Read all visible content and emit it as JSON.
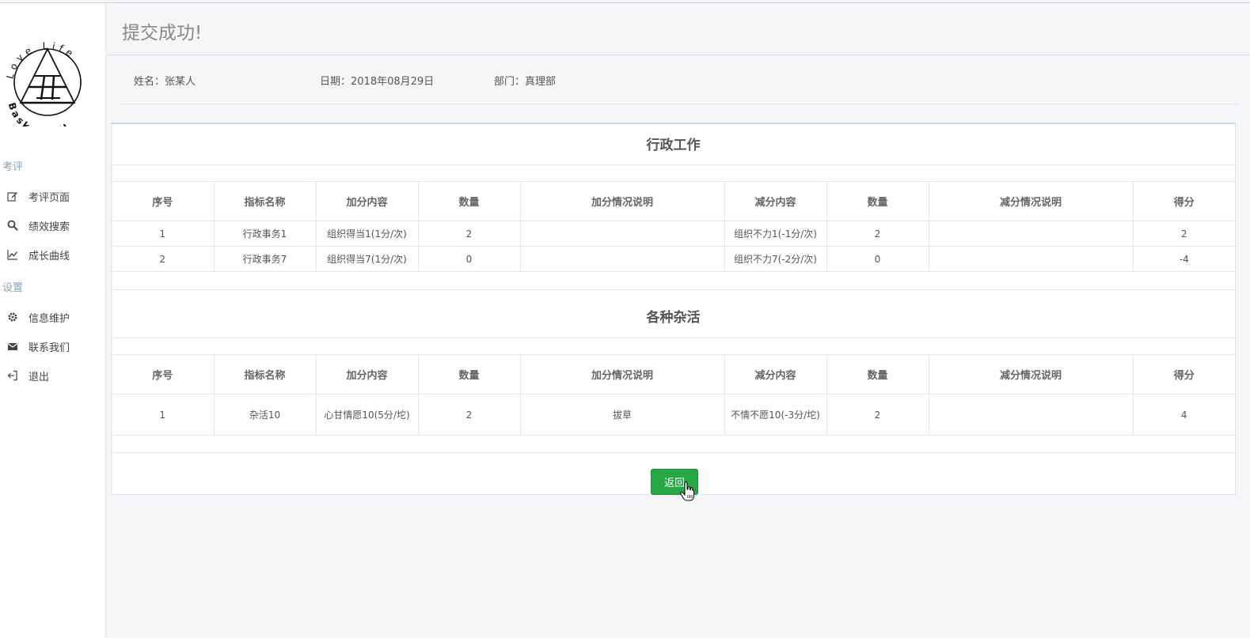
{
  "sidebar": {
    "logo": {
      "top_text": "Love Life",
      "bottom_text": "Basketball"
    },
    "section_review": "考评",
    "items_review": [
      {
        "label": "考评页面",
        "icon": "edit-icon"
      },
      {
        "label": "绩效搜索",
        "icon": "search-icon"
      },
      {
        "label": "成长曲线",
        "icon": "line-chart-icon"
      }
    ],
    "section_settings": "设置",
    "items_settings": [
      {
        "label": "信息维护",
        "icon": "gear-icon"
      },
      {
        "label": "联系我们",
        "icon": "envelope-icon"
      },
      {
        "label": "退出",
        "icon": "sign-out-icon"
      }
    ]
  },
  "header": {
    "title": "提交成功!"
  },
  "info": {
    "name": "姓名：张某人",
    "date": "日期：2018年08月29日",
    "department": "部门：真理部"
  },
  "columns": [
    "序号",
    "指标名称",
    "加分内容",
    "数量",
    "加分情况说明",
    "减分内容",
    "数量",
    "减分情况说明",
    "得分"
  ],
  "sections": [
    {
      "title": "行政工作",
      "rows": [
        [
          "1",
          "行政事务1",
          "组织得当1(1分/次)",
          "2",
          "",
          "组织不力1(-1分/次)",
          "2",
          "",
          "2"
        ],
        [
          "2",
          "行政事务7",
          "组织得当7(1分/次)",
          "0",
          "",
          "组织不力7(-2分/次)",
          "0",
          "",
          "-4"
        ]
      ]
    },
    {
      "title": "各种杂活",
      "rows": [
        [
          "1",
          "杂活10",
          "心甘情愿10(5分/坨)",
          "2",
          "拔草",
          "不情不愿10(-3分/坨)",
          "2",
          "",
          "4"
        ]
      ]
    }
  ],
  "actions": {
    "back_label": "返回"
  },
  "colors": {
    "button": "#28a745",
    "sidebar_section": "#8aa0b6"
  }
}
